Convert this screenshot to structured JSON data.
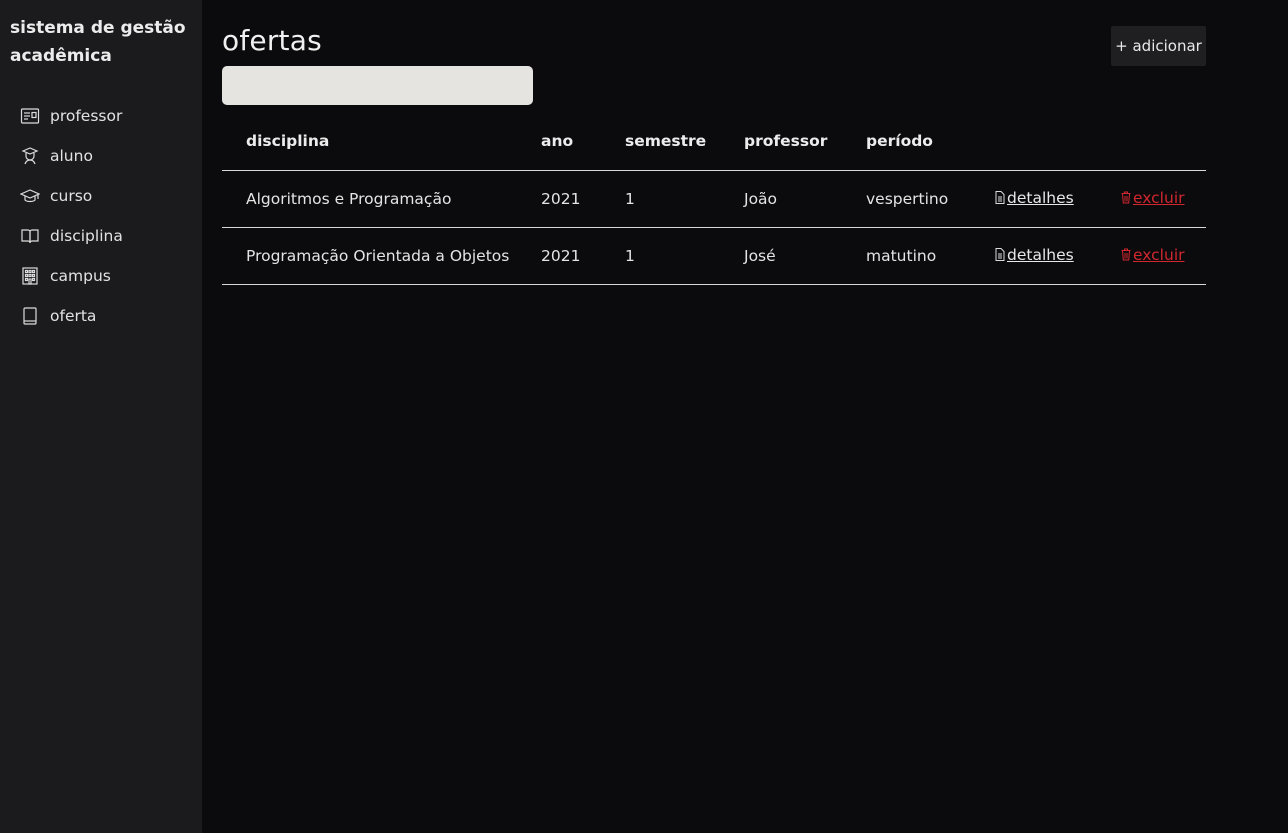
{
  "sidebar": {
    "brand": "sistema de gestão acadêmica",
    "items": [
      {
        "label": "professor",
        "icon": "id-card-icon"
      },
      {
        "label": "aluno",
        "icon": "student-icon"
      },
      {
        "label": "curso",
        "icon": "graduation-cap-icon"
      },
      {
        "label": "disciplina",
        "icon": "open-book-icon"
      },
      {
        "label": "campus",
        "icon": "building-icon"
      },
      {
        "label": "oferta",
        "icon": "book-icon"
      }
    ]
  },
  "main": {
    "title": "ofertas",
    "search": {
      "value": "",
      "placeholder": ""
    },
    "add_button": "+ adicionar",
    "table": {
      "headers": [
        "disciplina",
        "ano",
        "semestre",
        "professor",
        "período"
      ],
      "rows": [
        {
          "disciplina": "Algoritmos e Programação",
          "ano": "2021",
          "semestre": "1",
          "professor": "João",
          "periodo": "vespertino",
          "details": "detalhes",
          "delete": "excluir"
        },
        {
          "disciplina": "Programação Orientada a Objetos",
          "ano": "2021",
          "semestre": "1",
          "professor": "José",
          "periodo": "matutino",
          "details": "detalhes",
          "delete": "excluir"
        }
      ]
    }
  },
  "colors": {
    "sidebar_bg": "#1b1b1d",
    "main_bg": "#0b0b0d",
    "danger": "#d1272f",
    "search_bg": "#e5e4e1"
  }
}
